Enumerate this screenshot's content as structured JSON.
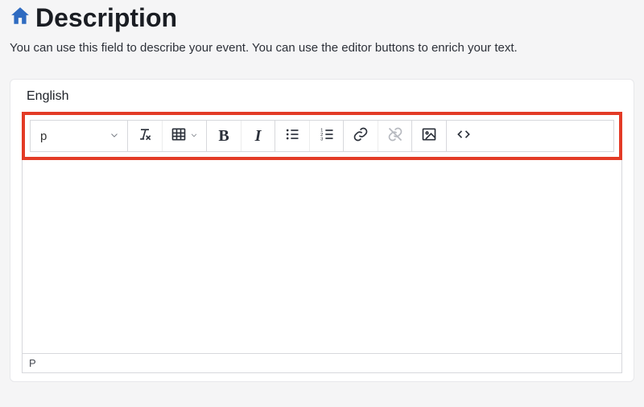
{
  "header": {
    "title": "Description",
    "subtitle": "You can use this field to describe your event. You can use the editor buttons to enrich your text."
  },
  "editor": {
    "language_label": "English",
    "format_selected": "p",
    "path": "P",
    "content": ""
  },
  "toolbar": {
    "bold": "B",
    "italic": "I"
  }
}
